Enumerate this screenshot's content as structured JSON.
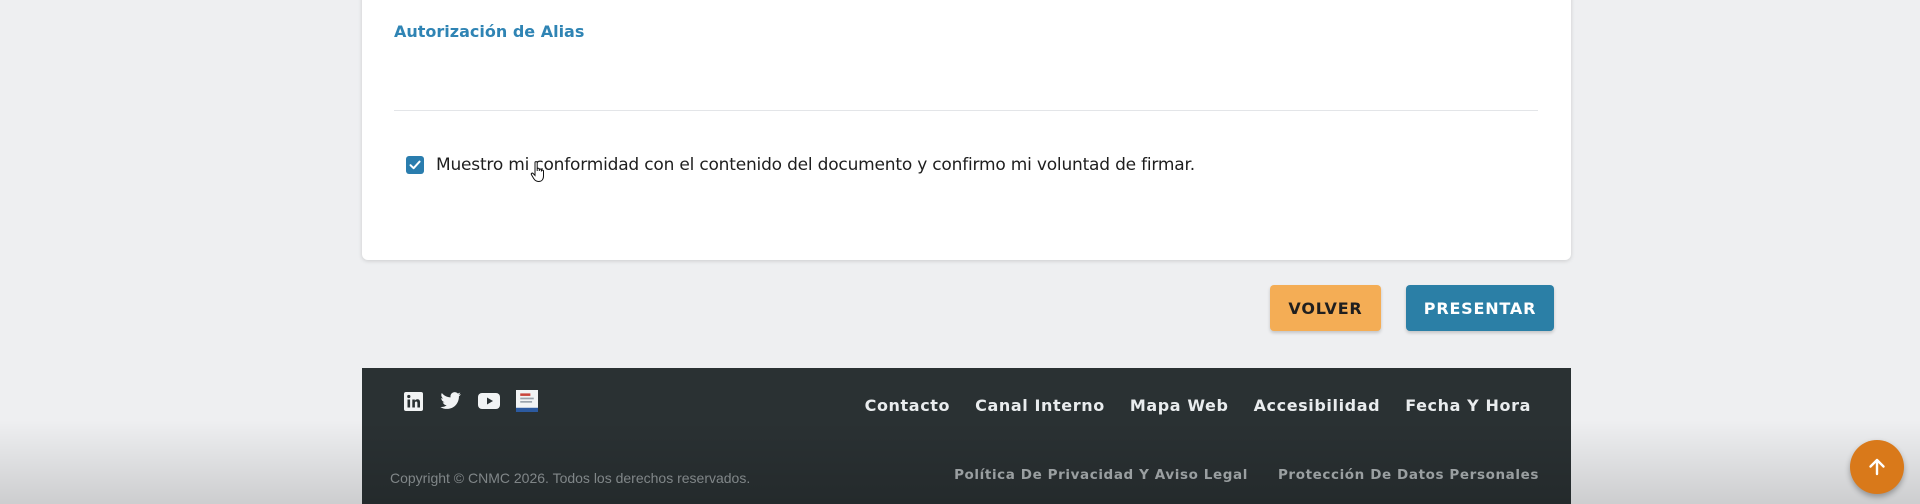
{
  "form": {
    "section_title": "Autorización de Alias",
    "consent": {
      "checked": true,
      "label": "Muestro mi conformidad con el contenido del documento y confirmo mi voluntad de firmar."
    }
  },
  "actions": {
    "back_label": "VOLVER",
    "submit_label": "PRESENTAR"
  },
  "footer": {
    "social_icons": [
      "linkedin-icon",
      "twitter-icon",
      "youtube-icon",
      "badge-icon"
    ],
    "links": [
      "Contacto",
      "Canal Interno",
      "Mapa Web",
      "Accesibilidad",
      "Fecha Y Hora"
    ],
    "copyright": "Copyright © CNMC 2026. Todos los derechos reservados.",
    "legal_links": [
      "Política De Privacidad Y Aviso Legal",
      "Protección De Datos Personales"
    ]
  },
  "colors": {
    "accent_blue": "#2b7fa6",
    "back_button": "#f4ad55",
    "footer_bg": "#2a3133",
    "scroll_top": "#d9791a"
  }
}
